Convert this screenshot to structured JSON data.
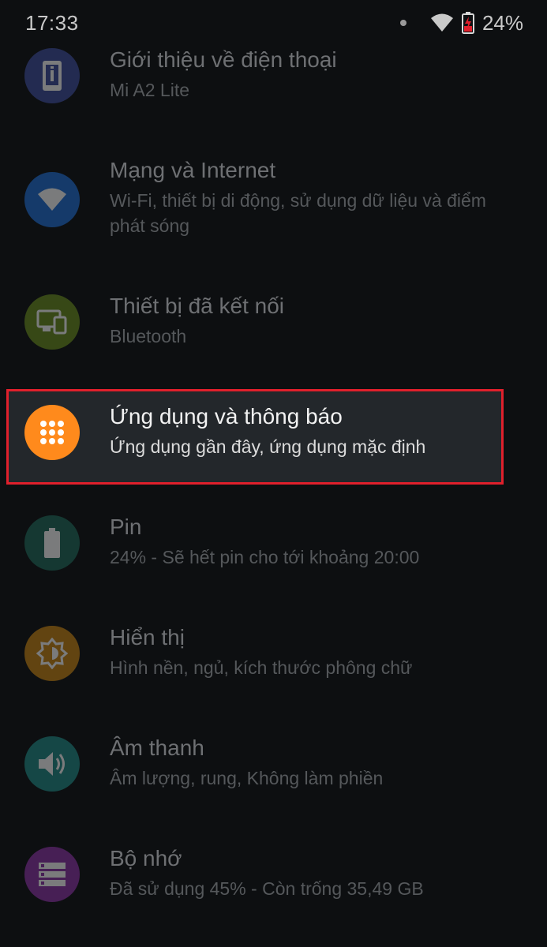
{
  "status_bar": {
    "time": "17:33",
    "battery_percent": "24%",
    "icons": [
      "notification-dot",
      "wifi-icon",
      "battery-charging-icon"
    ]
  },
  "settings": [
    {
      "id": "about",
      "title": "Giới thiệu về điện thoại",
      "subtitle": "Mi A2 Lite",
      "icon": "phone-info-icon",
      "color": "#3f4ea0"
    },
    {
      "id": "network",
      "title": "Mạng và Internet",
      "subtitle": "Wi-Fi, thiết bị di động, sử dụng dữ liệu và điểm phát sóng",
      "icon": "wifi-icon",
      "color": "#1f6fd6"
    },
    {
      "id": "connected",
      "title": "Thiết bị đã kết nối",
      "subtitle": "Bluetooth",
      "icon": "connected-devices-icon",
      "color": "#6b8e1e"
    },
    {
      "id": "apps",
      "title": "Ứng dụng và thông báo",
      "subtitle": "Ứng dụng gần đây, ứng dụng mặc định",
      "icon": "apps-grid-icon",
      "color": "#ff8a1c"
    },
    {
      "id": "battery",
      "title": "Pin",
      "subtitle": "24% - Sẽ hết pin cho tới khoảng 20:00",
      "icon": "battery-icon",
      "color": "#1f6b5a"
    },
    {
      "id": "display",
      "title": "Hiển thị",
      "subtitle": "Hình nền, ngủ, kích thước phông chữ",
      "icon": "brightness-icon",
      "color": "#c98412"
    },
    {
      "id": "sound",
      "title": "Âm thanh",
      "subtitle": "Âm lượng, rung, Không làm phiền",
      "icon": "volume-icon",
      "color": "#1f8b86"
    },
    {
      "id": "storage",
      "title": "Bộ nhớ",
      "subtitle": "Đã sử dụng 45% - Còn trống 35,49 GB",
      "icon": "storage-icon",
      "color": "#8e34a8"
    }
  ],
  "highlight": {
    "item": "apps",
    "border_color": "#e0202c"
  }
}
